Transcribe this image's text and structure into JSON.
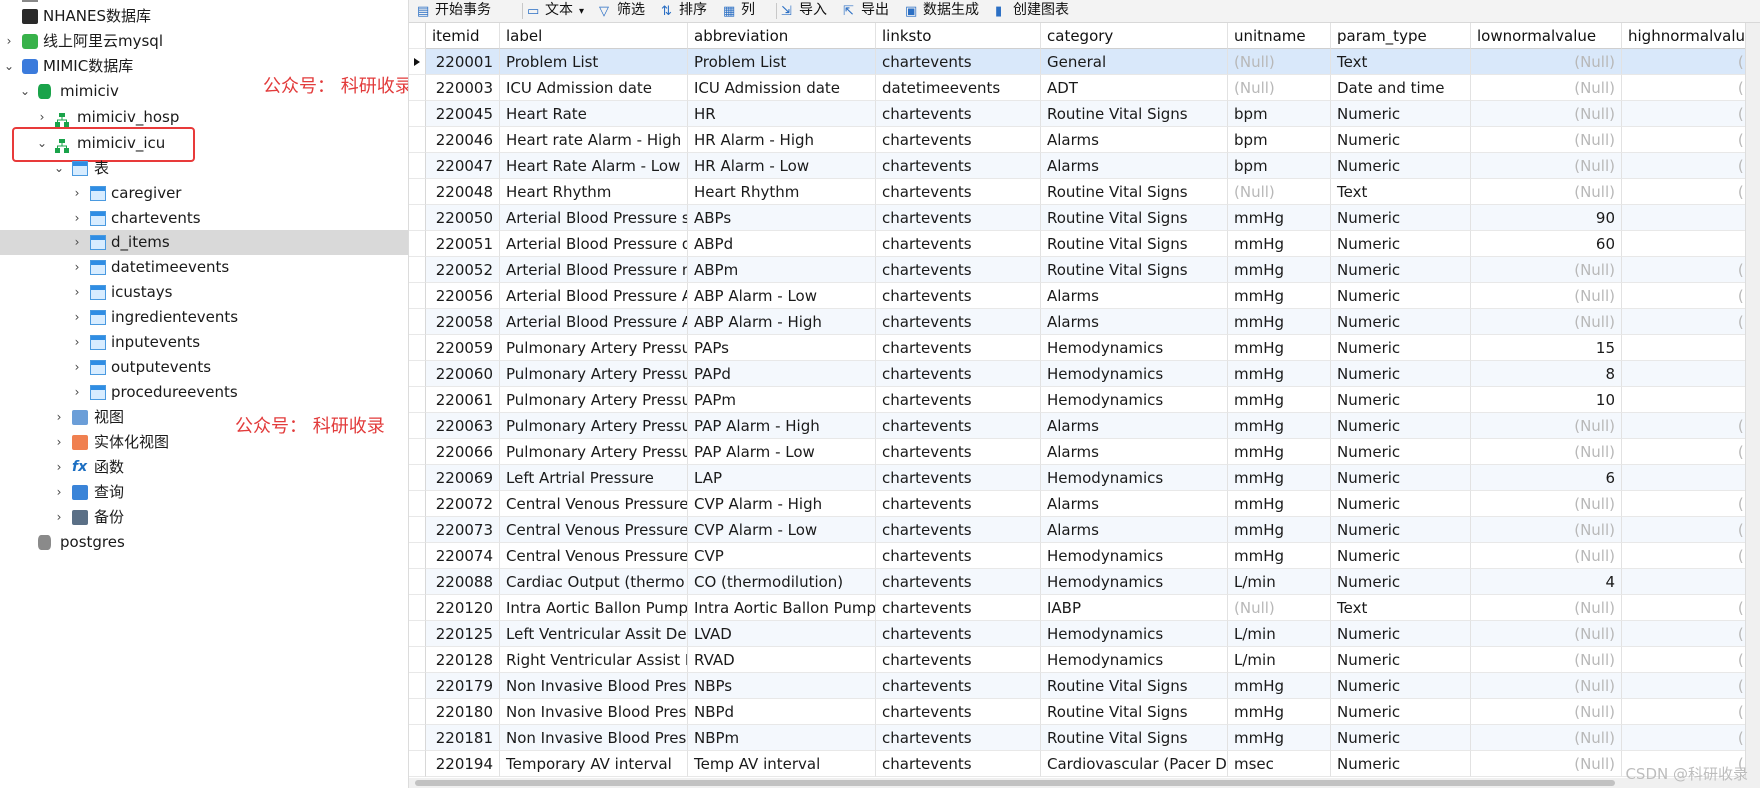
{
  "sidebar": {
    "items": [
      {
        "label": "NHANES数据库",
        "icon": "nhanes-db-icon"
      },
      {
        "label": "线上阿里云mysql",
        "icon": "cloud-connection-icon"
      },
      {
        "label": "MIMIC数据库",
        "icon": "mimic-connection-icon"
      },
      {
        "label": "mimiciv",
        "icon": "database-icon"
      },
      {
        "label": "mimiciv_hosp",
        "icon": "schema-icon"
      },
      {
        "label": "mimiciv_icu",
        "icon": "schema-icon"
      },
      {
        "label": "表",
        "icon": "tables-folder-icon"
      },
      {
        "label": "caregiver",
        "icon": "table-icon"
      },
      {
        "label": "chartevents",
        "icon": "table-icon"
      },
      {
        "label": "d_items",
        "icon": "table-icon"
      },
      {
        "label": "datetimeevents",
        "icon": "table-icon"
      },
      {
        "label": "icustays",
        "icon": "table-icon"
      },
      {
        "label": "ingredientevents",
        "icon": "table-icon"
      },
      {
        "label": "inputevents",
        "icon": "table-icon"
      },
      {
        "label": "outputevents",
        "icon": "table-icon"
      },
      {
        "label": "procedureevents",
        "icon": "table-icon"
      },
      {
        "label": "视图",
        "icon": "view-icon"
      },
      {
        "label": "实体化视图",
        "icon": "materialized-view-icon"
      },
      {
        "label": "函数",
        "icon": "function-icon"
      },
      {
        "label": "查询",
        "icon": "query-icon"
      },
      {
        "label": "备份",
        "icon": "backup-icon"
      },
      {
        "label": "postgres",
        "icon": "database-icon"
      }
    ],
    "watermark": "公众号： 科研收录"
  },
  "toolbar": {
    "begin_txn": "开始事务",
    "text": "文本",
    "filter": "筛选",
    "sort": "排序",
    "columns": "列",
    "import": "导入",
    "export": "导出",
    "datagen": "数据生成",
    "chart": "创建图表"
  },
  "table": {
    "columns": [
      "itemid",
      "label",
      "abbreviation",
      "linksto",
      "category",
      "unitname",
      "param_type",
      "lownormalvalue",
      "highnormalvalu"
    ],
    "rows": [
      [
        "220001",
        "Problem List",
        "Problem List",
        "chartevents",
        "General",
        "(Null)",
        "Text",
        "(Null)",
        "(N"
      ],
      [
        "220003",
        "ICU Admission date",
        "ICU Admission date",
        "datetimeevents",
        "ADT",
        "(Null)",
        "Date and time",
        "(Null)",
        "(N"
      ],
      [
        "220045",
        "Heart Rate",
        "HR",
        "chartevents",
        "Routine Vital Signs",
        "bpm",
        "Numeric",
        "(Null)",
        "(N"
      ],
      [
        "220046",
        "Heart rate Alarm - High",
        "HR Alarm - High",
        "chartevents",
        "Alarms",
        "bpm",
        "Numeric",
        "(Null)",
        "(N"
      ],
      [
        "220047",
        "Heart Rate Alarm - Low",
        "HR Alarm - Low",
        "chartevents",
        "Alarms",
        "bpm",
        "Numeric",
        "(Null)",
        "(N"
      ],
      [
        "220048",
        "Heart Rhythm",
        "Heart Rhythm",
        "chartevents",
        "Routine Vital Signs",
        "(Null)",
        "Text",
        "(Null)",
        "(N"
      ],
      [
        "220050",
        "Arterial Blood Pressure s",
        "ABPs",
        "chartevents",
        "Routine Vital Signs",
        "mmHg",
        "Numeric",
        "90",
        ""
      ],
      [
        "220051",
        "Arterial Blood Pressure d",
        "ABPd",
        "chartevents",
        "Routine Vital Signs",
        "mmHg",
        "Numeric",
        "60",
        ""
      ],
      [
        "220052",
        "Arterial Blood Pressure m",
        "ABPm",
        "chartevents",
        "Routine Vital Signs",
        "mmHg",
        "Numeric",
        "(Null)",
        "(N"
      ],
      [
        "220056",
        "Arterial Blood Pressure A",
        "ABP Alarm - Low",
        "chartevents",
        "Alarms",
        "mmHg",
        "Numeric",
        "(Null)",
        "(N"
      ],
      [
        "220058",
        "Arterial Blood Pressure A",
        "ABP Alarm - High",
        "chartevents",
        "Alarms",
        "mmHg",
        "Numeric",
        "(Null)",
        "(N"
      ],
      [
        "220059",
        "Pulmonary Artery Pressu",
        "PAPs",
        "chartevents",
        "Hemodynamics",
        "mmHg",
        "Numeric",
        "15",
        ""
      ],
      [
        "220060",
        "Pulmonary Artery Pressu",
        "PAPd",
        "chartevents",
        "Hemodynamics",
        "mmHg",
        "Numeric",
        "8",
        ""
      ],
      [
        "220061",
        "Pulmonary Artery Pressu",
        "PAPm",
        "chartevents",
        "Hemodynamics",
        "mmHg",
        "Numeric",
        "10",
        ""
      ],
      [
        "220063",
        "Pulmonary Artery Pressu",
        "PAP Alarm - High",
        "chartevents",
        "Alarms",
        "mmHg",
        "Numeric",
        "(Null)",
        "(N"
      ],
      [
        "220066",
        "Pulmonary Artery Pressu",
        "PAP Alarm - Low",
        "chartevents",
        "Alarms",
        "mmHg",
        "Numeric",
        "(Null)",
        "(N"
      ],
      [
        "220069",
        "Left Artrial Pressure",
        "LAP",
        "chartevents",
        "Hemodynamics",
        "mmHg",
        "Numeric",
        "6",
        ""
      ],
      [
        "220072",
        "Central Venous Pressure",
        "CVP Alarm - High",
        "chartevents",
        "Alarms",
        "mmHg",
        "Numeric",
        "(Null)",
        "(N"
      ],
      [
        "220073",
        "Central Venous Pressure",
        "CVP Alarm - Low",
        "chartevents",
        "Alarms",
        "mmHg",
        "Numeric",
        "(Null)",
        "(N"
      ],
      [
        "220074",
        "Central Venous Pressure",
        "CVP",
        "chartevents",
        "Hemodynamics",
        "mmHg",
        "Numeric",
        "(Null)",
        "(N"
      ],
      [
        "220088",
        "Cardiac Output (thermo",
        "CO (thermodilution)",
        "chartevents",
        "Hemodynamics",
        "L/min",
        "Numeric",
        "4",
        ""
      ],
      [
        "220120",
        "Intra Aortic Ballon Pump",
        "Intra Aortic Ballon Pump",
        "chartevents",
        "IABP",
        "(Null)",
        "Text",
        "(Null)",
        "(N"
      ],
      [
        "220125",
        "Left Ventricular Assit De",
        "LVAD",
        "chartevents",
        "Hemodynamics",
        "L/min",
        "Numeric",
        "(Null)",
        "(N"
      ],
      [
        "220128",
        "Right Ventricular Assist I",
        "RVAD",
        "chartevents",
        "Hemodynamics",
        "L/min",
        "Numeric",
        "(Null)",
        "(N"
      ],
      [
        "220179",
        "Non Invasive Blood Pres",
        "NBPs",
        "chartevents",
        "Routine Vital Signs",
        "mmHg",
        "Numeric",
        "(Null)",
        "(N"
      ],
      [
        "220180",
        "Non Invasive Blood Pres",
        "NBPd",
        "chartevents",
        "Routine Vital Signs",
        "mmHg",
        "Numeric",
        "(Null)",
        "(N"
      ],
      [
        "220181",
        "Non Invasive Blood Pres",
        "NBPm",
        "chartevents",
        "Routine Vital Signs",
        "mmHg",
        "Numeric",
        "(Null)",
        "(N"
      ],
      [
        "220194",
        "Temporary AV interval",
        "Temp AV interval",
        "chartevents",
        "Cardiovascular (Pacer Da",
        "msec",
        "Numeric",
        "(Null)",
        "(N"
      ]
    ]
  },
  "watermark_csdn": "CSDN @科研收录",
  "colors": {
    "selection": "#d9e8fa",
    "null_text": "#b8b8b8",
    "highlight_box": "#e83a3a",
    "watermark_red": "#e23b3b"
  }
}
